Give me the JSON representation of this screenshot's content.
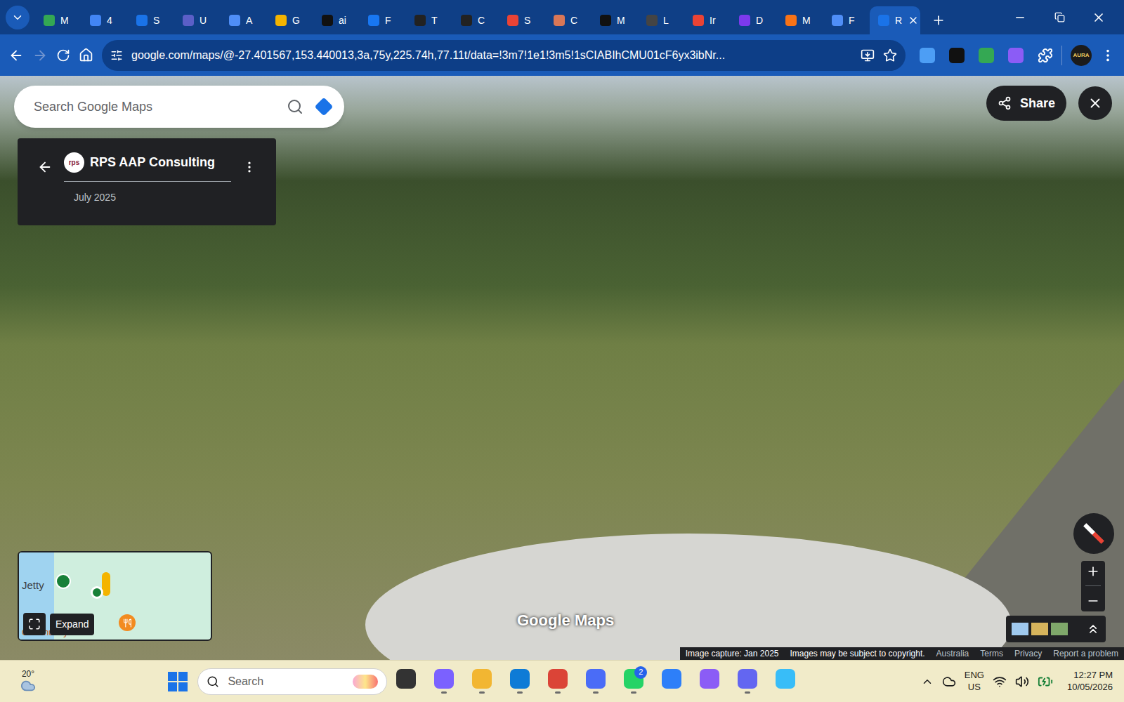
{
  "browser": {
    "tabs": [
      {
        "label": "M",
        "selected": false,
        "color": "#34a853"
      },
      {
        "label": "4",
        "selected": false,
        "color": "#4285f4"
      },
      {
        "label": "S",
        "selected": false,
        "color": "#1a73e8"
      },
      {
        "label": "U",
        "selected": false,
        "color": "#5b5fc7"
      },
      {
        "label": "A",
        "selected": false,
        "color": "#4f8ef7"
      },
      {
        "label": "G",
        "selected": false,
        "color": "#f4b400"
      },
      {
        "label": "ai",
        "selected": false,
        "color": "#111111"
      },
      {
        "label": "F",
        "selected": false,
        "color": "#1877f2"
      },
      {
        "label": "T",
        "selected": false,
        "color": "#222222"
      },
      {
        "label": "C",
        "selected": false,
        "color": "#222222"
      },
      {
        "label": "S",
        "selected": false,
        "color": "#ea4335"
      },
      {
        "label": "C",
        "selected": false,
        "color": "#d97757"
      },
      {
        "label": "M",
        "selected": false,
        "color": "#111111"
      },
      {
        "label": "L",
        "selected": false,
        "color": "#444444"
      },
      {
        "label": "Ir",
        "selected": false,
        "color": "#ea4335"
      },
      {
        "label": "D",
        "selected": false,
        "color": "#7c3aed"
      },
      {
        "label": "M",
        "selected": false,
        "color": "#f97316"
      },
      {
        "label": "F",
        "selected": false,
        "color": "#4f8ef7"
      },
      {
        "label": "R",
        "selected": true,
        "color": "#1a73e8"
      }
    ],
    "address": "google.com/maps/@-27.401567,153.440013,3a,75y,225.74h,77.11t/data=!3m7!1e1!3m5!1sCIABIhCMU01cF6yx3ibNr...",
    "forward_disabled": true,
    "extensions": [
      {
        "color": "#4d9ef5"
      },
      {
        "color": "#111111"
      },
      {
        "color": "#34a853"
      },
      {
        "color": "#8b5cf6"
      }
    ],
    "profile": "AURA"
  },
  "maps": {
    "search": {
      "placeholder": "Search Google Maps"
    },
    "place": {
      "logo": "rps",
      "name": "RPS AAP Consulting",
      "date": "July 2025"
    },
    "share": "Share",
    "minimap": {
      "labels": [
        "Jetty",
        "Community Club"
      ],
      "tooltip": "Expand"
    },
    "watermark": "Google Maps",
    "footer": [
      {
        "text": "Image capture: Jan 2025",
        "bright": true
      },
      {
        "text": "Images may be subject to copyright.",
        "bright": true
      },
      {
        "text": "Australia",
        "bright": false
      },
      {
        "text": "Terms",
        "bright": false
      },
      {
        "text": "Privacy",
        "bright": false
      },
      {
        "text": "Report a problem",
        "bright": false
      }
    ]
  },
  "taskbar": {
    "weather": "20°",
    "search": "Search",
    "apps": [
      {
        "color": "#333333",
        "badge": "",
        "running": false
      },
      {
        "color": "#7b61ff",
        "badge": "",
        "running": true
      },
      {
        "color": "#f2b632",
        "badge": "",
        "running": true
      },
      {
        "color": "#0e7bd6",
        "badge": "",
        "running": true
      },
      {
        "color": "#db4437",
        "badge": "",
        "running": true
      },
      {
        "color": "#4a6cf7",
        "badge": "",
        "running": true
      },
      {
        "color": "#25d366",
        "badge": "2",
        "running": true
      },
      {
        "color": "#2d7ff9",
        "badge": "",
        "running": false
      },
      {
        "color": "#8b5cf6",
        "badge": "",
        "running": false
      },
      {
        "color": "#6366f1",
        "badge": "",
        "running": true
      },
      {
        "color": "#38bdf8",
        "badge": "",
        "running": false
      }
    ],
    "tray": {
      "lang": "ENG",
      "region": "US",
      "time": "12:27 PM",
      "date": "10/05/2026"
    }
  }
}
